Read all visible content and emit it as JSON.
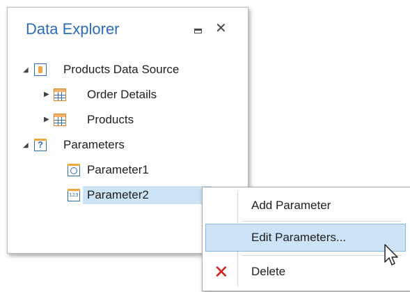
{
  "panel": {
    "title": "Data Explorer",
    "pin_icon": "pin-icon",
    "close_label": "✕"
  },
  "tree": {
    "datasource": {
      "label": "Products Data Source",
      "icon": "datasource-icon"
    },
    "tables": [
      {
        "label": "Order Details",
        "icon": "table-icon"
      },
      {
        "label": "Products",
        "icon": "table-icon"
      }
    ],
    "parameters": {
      "label": "Parameters",
      "icon": "parameters-icon",
      "icon_glyph": "?"
    },
    "params": [
      {
        "label": "Parameter1",
        "icon": "clock-icon"
      },
      {
        "label": "Parameter2",
        "icon": "number-icon",
        "icon_glyph": "123",
        "selected": true
      }
    ]
  },
  "context_menu": {
    "items": [
      {
        "label": "Add Parameter"
      },
      {
        "label": "Edit Parameters...",
        "highlighted": true
      },
      {
        "label": "Delete",
        "icon": "delete-icon"
      }
    ]
  },
  "colors": {
    "title": "#2b6cb8",
    "selection": "#cde3f6",
    "delete": "#d81f1f"
  }
}
